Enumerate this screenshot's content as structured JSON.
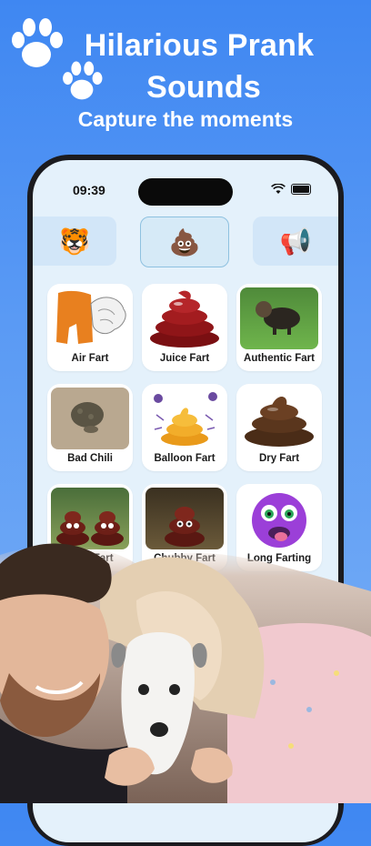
{
  "headline": {
    "line1": "Hilarious Prank",
    "line2": "Sounds",
    "tagline": "Capture the moments"
  },
  "status": {
    "time": "09:39",
    "icons": [
      "wifi-icon",
      "battery-icon"
    ]
  },
  "tabs": [
    {
      "icon": "tiger-face-icon",
      "glyph": "🐯",
      "active": false
    },
    {
      "icon": "poop-icon",
      "glyph": "💩",
      "active": true
    },
    {
      "icon": "megaphone-icon",
      "glyph": "📢",
      "active": false
    }
  ],
  "sounds": [
    {
      "label": "Air Fart"
    },
    {
      "label": "Juice Fart"
    },
    {
      "label": "Authentic Fart"
    },
    {
      "label": "Bad Chili"
    },
    {
      "label": "Balloon Fart"
    },
    {
      "label": "Dry Fart"
    },
    {
      "label": "Hard Fart"
    },
    {
      "label": "Chubby Fart"
    },
    {
      "label": "Long Farting"
    }
  ],
  "colors": {
    "background_top": "#3f87f2",
    "screen": "#e4f1fb",
    "tab": "#d2e6f8",
    "tab_active_border": "#8ec1e0",
    "card": "#ffffff"
  }
}
